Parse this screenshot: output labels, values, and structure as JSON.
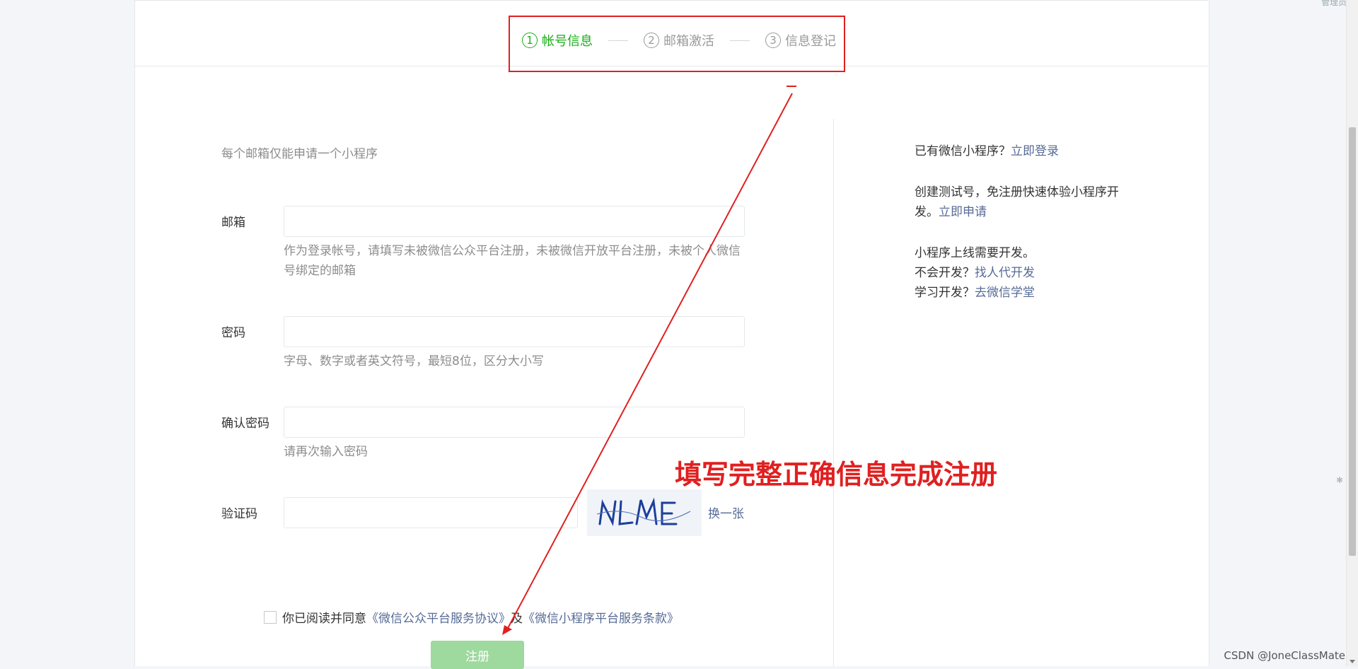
{
  "header": {
    "corner_text": "管理员"
  },
  "steps": [
    {
      "num": "1",
      "label": "帐号信息"
    },
    {
      "num": "2",
      "label": "邮箱激活"
    },
    {
      "num": "3",
      "label": "信息登记"
    }
  ],
  "form": {
    "tip": "每个邮箱仅能申请一个小程序",
    "email": {
      "label": "邮箱",
      "value": "",
      "hint": "作为登录帐号，请填写未被微信公众平台注册，未被微信开放平台注册，未被个人微信号绑定的邮箱"
    },
    "password": {
      "label": "密码",
      "value": "",
      "hint": "字母、数字或者英文符号，最短8位，区分大小写"
    },
    "confirm": {
      "label": "确认密码",
      "value": "",
      "hint": "请再次输入密码"
    },
    "captcha": {
      "label": "验证码",
      "value": "",
      "image_text": "NLME",
      "swap": "换一张"
    },
    "agree": {
      "prefix": "你已阅读并同意",
      "link1": "《微信公众平台服务协议》",
      "and": "及",
      "link2": "《微信小程序平台服务条款》"
    },
    "submit": "注册"
  },
  "side": {
    "login_q": "已有微信小程序？",
    "login_link": "立即登录",
    "test_text": "创建测试号，免注册快速体验小程序开发。",
    "test_link": "立即申请",
    "dev_need": "小程序上线需要开发。",
    "no_dev_q": "不会开发？",
    "no_dev_link": "找人代开发",
    "learn_q": "学习开发？",
    "learn_link": "去微信学堂"
  },
  "annotation": {
    "text": "填写完整正确信息完成注册",
    "color": "#e02020"
  },
  "watermark": "CSDN @JoneClassMate",
  "colors": {
    "accent_green": "#1aad19",
    "link": "#576b95",
    "button_disabled": "#9ed99d"
  }
}
